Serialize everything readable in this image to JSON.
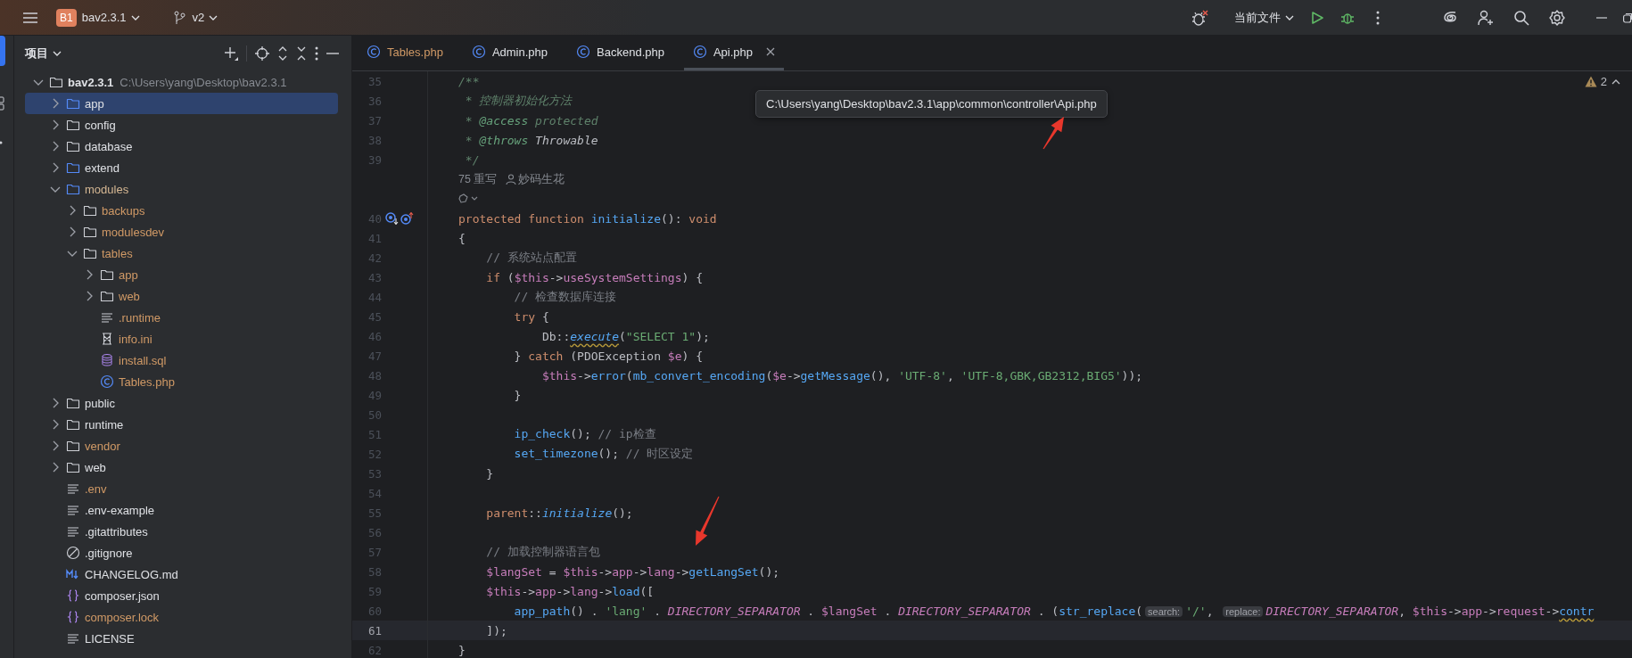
{
  "topbar": {
    "project_badge": "B1",
    "project": "bav2.3.1",
    "branch": "v2",
    "run_config": "当前文件"
  },
  "project_panel": {
    "title": "项目",
    "tree": [
      {
        "label": "bav2.3.1",
        "path": "C:\\Users\\yang\\Desktop\\bav2.3.1",
        "kind": "folder",
        "color": "#dfe1e5",
        "expanded": true,
        "selected": false,
        "children": [
          {
            "label": "app",
            "kind": "source-folder",
            "color": "#dfe1e5",
            "expanded": false,
            "selected": true
          },
          {
            "label": "config",
            "kind": "folder",
            "color": "#dfe1e5",
            "expanded": false,
            "selected": false
          },
          {
            "label": "database",
            "kind": "folder",
            "color": "#dfe1e5",
            "expanded": false,
            "selected": false
          },
          {
            "label": "extend",
            "kind": "source-folder",
            "color": "#dfe1e5",
            "expanded": false,
            "selected": false
          },
          {
            "label": "modules",
            "kind": "source-folder",
            "color": "#d5b793",
            "expanded": true,
            "selected": false,
            "children": [
              {
                "label": "backups",
                "kind": "folder",
                "color": "#d19a66",
                "expanded": false,
                "selected": false
              },
              {
                "label": "modulesdev",
                "kind": "folder",
                "color": "#d19a66",
                "expanded": false,
                "selected": false
              },
              {
                "label": "tables",
                "kind": "folder",
                "color": "#d19a66",
                "expanded": true,
                "selected": false,
                "children": [
                  {
                    "label": "app",
                    "kind": "folder",
                    "color": "#d19a66",
                    "expanded": false,
                    "selected": false
                  },
                  {
                    "label": "web",
                    "kind": "folder",
                    "color": "#d19a66",
                    "expanded": false,
                    "selected": false
                  },
                  {
                    "label": ".runtime",
                    "kind": "text",
                    "color": "#d19a66",
                    "selected": false
                  },
                  {
                    "label": "info.ini",
                    "kind": "ini",
                    "color": "#d19a66",
                    "selected": false
                  },
                  {
                    "label": "install.sql",
                    "kind": "database",
                    "color": "#d19a66",
                    "selected": false
                  },
                  {
                    "label": "Tables.php",
                    "kind": "php-class",
                    "color": "#d19a66",
                    "selected": false
                  }
                ]
              }
            ]
          },
          {
            "label": "public",
            "kind": "folder",
            "color": "#dfe1e5",
            "expanded": false,
            "selected": false
          },
          {
            "label": "runtime",
            "kind": "folder",
            "color": "#dfe1e5",
            "expanded": false,
            "selected": false
          },
          {
            "label": "vendor",
            "kind": "folder",
            "color": "#d19a66",
            "expanded": false,
            "selected": false
          },
          {
            "label": "web",
            "kind": "folder",
            "color": "#dfe1e5",
            "expanded": false,
            "selected": false
          },
          {
            "label": ".env",
            "kind": "text",
            "color": "#d19a66",
            "selected": false
          },
          {
            "label": ".env-example",
            "kind": "text",
            "color": "#dfe1e5",
            "selected": false
          },
          {
            "label": ".gitattributes",
            "kind": "text",
            "color": "#dfe1e5",
            "selected": false
          },
          {
            "label": ".gitignore",
            "kind": "ignore",
            "color": "#dfe1e5",
            "selected": false
          },
          {
            "label": "CHANGELOG.md",
            "kind": "markdown",
            "color": "#dfe1e5",
            "selected": false
          },
          {
            "label": "composer.json",
            "kind": "json",
            "color": "#dfe1e5",
            "selected": false
          },
          {
            "label": "composer.lock",
            "kind": "json",
            "color": "#d19a66",
            "selected": false
          },
          {
            "label": "LICENSE",
            "kind": "text",
            "color": "#dfe1e5",
            "selected": false
          }
        ]
      }
    ]
  },
  "tabs": [
    {
      "label": "Tables.php",
      "color": "#d19a66",
      "selected": false
    },
    {
      "label": "Admin.php",
      "color": "#dfe1e5",
      "selected": false
    },
    {
      "label": "Backend.php",
      "color": "#dfe1e5",
      "selected": false
    },
    {
      "label": "Api.php",
      "color": "#dfe1e5",
      "selected": true
    }
  ],
  "editor": {
    "problems": "2",
    "tooltip": "C:\\Users\\yang\\Desktop\\bav2.3.1\\app\\common\\controller\\Api.php",
    "lines": [
      {
        "kind": "code",
        "number": "35",
        "current": false,
        "marked": false,
        "segments": [
          {
            "kind": "doc",
            "text": "/**"
          }
        ]
      },
      {
        "kind": "code",
        "number": "36",
        "current": false,
        "marked": false,
        "segments": [
          {
            "kind": "doc",
            "text": " * 控制器初始化方法"
          }
        ]
      },
      {
        "kind": "code",
        "number": "37",
        "current": false,
        "marked": false,
        "segments": [
          {
            "kind": "doc",
            "text": " * "
          },
          {
            "kind": "doc_tag",
            "text": "@access"
          },
          {
            "kind": "doc",
            "text": " protected"
          }
        ]
      },
      {
        "kind": "code",
        "number": "38",
        "current": false,
        "marked": false,
        "segments": [
          {
            "kind": "doc",
            "text": " * "
          },
          {
            "kind": "doc_tag",
            "text": "@throws"
          },
          {
            "kind": "doc_type",
            "text": " Throwable"
          }
        ]
      },
      {
        "kind": "code",
        "number": "39",
        "current": false,
        "marked": false,
        "segments": [
          {
            "kind": "doc",
            "text": " */"
          }
        ]
      },
      {
        "kind": "usage_hint",
        "usages": "75 重写",
        "author": "妙码生花"
      },
      {
        "kind": "ai_hint"
      },
      {
        "kind": "code",
        "number": "40",
        "current": false,
        "marked": true,
        "segments": [
          {
            "kind": "kw",
            "text": "protected function "
          },
          {
            "kind": "fn",
            "text": "initialize"
          },
          {
            "kind": "plain",
            "text": "(): "
          },
          {
            "kind": "kw",
            "text": "void"
          }
        ]
      },
      {
        "kind": "code",
        "number": "41",
        "current": false,
        "marked": false,
        "segments": [
          {
            "kind": "plain",
            "text": "{"
          }
        ]
      },
      {
        "kind": "code",
        "number": "42",
        "current": false,
        "marked": false,
        "segments": [
          {
            "kind": "comment",
            "text": "    // 系统站点配置"
          }
        ]
      },
      {
        "kind": "code",
        "number": "43",
        "current": false,
        "marked": false,
        "segments": [
          {
            "kind": "kw",
            "text": "    if"
          },
          {
            "kind": "plain",
            "text": " ("
          },
          {
            "kind": "var",
            "text": "$this"
          },
          {
            "kind": "plain",
            "text": "->"
          },
          {
            "kind": "field",
            "text": "useSystemSettings"
          },
          {
            "kind": "plain",
            "text": ") {"
          }
        ]
      },
      {
        "kind": "code",
        "number": "44",
        "current": false,
        "marked": false,
        "segments": [
          {
            "kind": "comment",
            "text": "        // 检查数据库连接"
          }
        ]
      },
      {
        "kind": "code",
        "number": "45",
        "current": false,
        "marked": false,
        "segments": [
          {
            "kind": "kw",
            "text": "        try"
          },
          {
            "kind": "plain",
            "text": " {"
          }
        ]
      },
      {
        "kind": "code",
        "number": "46",
        "current": false,
        "marked": false,
        "segments": [
          {
            "kind": "plain",
            "text": "            Db::"
          },
          {
            "kind": "fn_italic",
            "text": "execute",
            "squiggle": true
          },
          {
            "kind": "plain",
            "text": "("
          },
          {
            "kind": "str",
            "text": "\"SELECT 1\""
          },
          {
            "kind": "plain",
            "text": ");"
          }
        ]
      },
      {
        "kind": "code",
        "number": "47",
        "current": false,
        "marked": false,
        "segments": [
          {
            "kind": "plain",
            "text": "        } "
          },
          {
            "kind": "kw",
            "text": "catch"
          },
          {
            "kind": "plain",
            "text": " (PDOException "
          },
          {
            "kind": "var",
            "text": "$e"
          },
          {
            "kind": "plain",
            "text": ") {"
          }
        ]
      },
      {
        "kind": "code",
        "number": "48",
        "current": false,
        "marked": false,
        "segments": [
          {
            "kind": "var",
            "text": "            $this"
          },
          {
            "kind": "plain",
            "text": "->"
          },
          {
            "kind": "fn",
            "text": "error"
          },
          {
            "kind": "plain",
            "text": "("
          },
          {
            "kind": "fn",
            "text": "mb_convert_encoding"
          },
          {
            "kind": "plain",
            "text": "("
          },
          {
            "kind": "var",
            "text": "$e"
          },
          {
            "kind": "plain",
            "text": "->"
          },
          {
            "kind": "fn",
            "text": "getMessage"
          },
          {
            "kind": "plain",
            "text": "(), "
          },
          {
            "kind": "str",
            "text": "'UTF-8'"
          },
          {
            "kind": "plain",
            "text": ", "
          },
          {
            "kind": "str",
            "text": "'UTF-8,GBK,GB2312,BIG5'"
          },
          {
            "kind": "plain",
            "text": "));"
          }
        ]
      },
      {
        "kind": "code",
        "number": "49",
        "current": false,
        "marked": false,
        "segments": [
          {
            "kind": "plain",
            "text": "        }"
          }
        ]
      },
      {
        "kind": "code",
        "number": "50",
        "current": false,
        "marked": false
      },
      {
        "kind": "code",
        "number": "51",
        "current": false,
        "marked": false,
        "segments": [
          {
            "kind": "fn",
            "text": "        ip_check"
          },
          {
            "kind": "plain",
            "text": "(); "
          },
          {
            "kind": "comment",
            "text": "// ip检查"
          }
        ]
      },
      {
        "kind": "code",
        "number": "52",
        "current": false,
        "marked": false,
        "segments": [
          {
            "kind": "fn",
            "text": "        set_timezone"
          },
          {
            "kind": "plain",
            "text": "(); "
          },
          {
            "kind": "comment",
            "text": "// 时区设定"
          }
        ]
      },
      {
        "kind": "code",
        "number": "53",
        "current": false,
        "marked": false,
        "segments": [
          {
            "kind": "plain",
            "text": "    }"
          }
        ]
      },
      {
        "kind": "code",
        "number": "54",
        "current": false,
        "marked": false
      },
      {
        "kind": "code",
        "number": "55",
        "current": false,
        "marked": false,
        "segments": [
          {
            "kind": "kw",
            "text": "    parent"
          },
          {
            "kind": "plain",
            "text": "::"
          },
          {
            "kind": "fn_italic",
            "text": "initialize"
          },
          {
            "kind": "plain",
            "text": "();"
          }
        ]
      },
      {
        "kind": "code",
        "number": "56",
        "current": false,
        "marked": false
      },
      {
        "kind": "code",
        "number": "57",
        "current": false,
        "marked": false,
        "segments": [
          {
            "kind": "comment",
            "text": "    // 加载控制器语言包"
          }
        ]
      },
      {
        "kind": "code",
        "number": "58",
        "current": false,
        "marked": false,
        "segments": [
          {
            "kind": "var",
            "text": "    $langSet"
          },
          {
            "kind": "plain",
            "text": " = "
          },
          {
            "kind": "var",
            "text": "$this"
          },
          {
            "kind": "plain",
            "text": "->"
          },
          {
            "kind": "field",
            "text": "app"
          },
          {
            "kind": "plain",
            "text": "->"
          },
          {
            "kind": "field",
            "text": "lang"
          },
          {
            "kind": "plain",
            "text": "->"
          },
          {
            "kind": "fn",
            "text": "getLangSet"
          },
          {
            "kind": "plain",
            "text": "();"
          }
        ]
      },
      {
        "kind": "code",
        "number": "59",
        "current": false,
        "marked": false,
        "segments": [
          {
            "kind": "var",
            "text": "    $this"
          },
          {
            "kind": "plain",
            "text": "->"
          },
          {
            "kind": "field",
            "text": "app"
          },
          {
            "kind": "plain",
            "text": "->"
          },
          {
            "kind": "field",
            "text": "lang"
          },
          {
            "kind": "plain",
            "text": "->"
          },
          {
            "kind": "fn",
            "text": "load"
          },
          {
            "kind": "plain",
            "text": "(["
          }
        ]
      },
      {
        "kind": "code",
        "number": "60",
        "current": false,
        "marked": false,
        "segments": [
          {
            "kind": "fn",
            "text": "        app_path"
          },
          {
            "kind": "plain",
            "text": "() . "
          },
          {
            "kind": "str",
            "text": "'lang'"
          },
          {
            "kind": "plain",
            "text": " . "
          },
          {
            "kind": "const",
            "text": "DIRECTORY_SEPARATOR"
          },
          {
            "kind": "plain",
            "text": " . "
          },
          {
            "kind": "var",
            "text": "$langSet"
          },
          {
            "kind": "plain",
            "text": " . "
          },
          {
            "kind": "const",
            "text": "DIRECTORY_SEPARATOR"
          },
          {
            "kind": "plain",
            "text": " . ("
          },
          {
            "kind": "fn",
            "text": "str_replace"
          },
          {
            "kind": "plain",
            "text": "("
          },
          {
            "kind": "hint",
            "text": "search:"
          },
          {
            "kind": "str",
            "text": "'/'"
          },
          {
            "kind": "plain",
            "text": ", "
          },
          {
            "kind": "hint",
            "text": "replace:"
          },
          {
            "kind": "const",
            "text": "DIRECTORY_SEPARATOR"
          },
          {
            "kind": "plain",
            "text": ", "
          },
          {
            "kind": "var",
            "text": "$this"
          },
          {
            "kind": "plain",
            "text": "->"
          },
          {
            "kind": "field",
            "text": "app"
          },
          {
            "kind": "plain",
            "text": "->"
          },
          {
            "kind": "field",
            "text": "request"
          },
          {
            "kind": "plain",
            "text": "->"
          },
          {
            "kind": "fn",
            "text": "contr",
            "squiggle": true
          }
        ]
      },
      {
        "kind": "code",
        "number": "61",
        "current": true,
        "marked": false,
        "segments": [
          {
            "kind": "plain",
            "text": "    ]);"
          }
        ]
      },
      {
        "kind": "code",
        "number": "62",
        "current": false,
        "marked": false,
        "segments": [
          {
            "kind": "plain",
            "text": "}"
          }
        ]
      }
    ]
  }
}
